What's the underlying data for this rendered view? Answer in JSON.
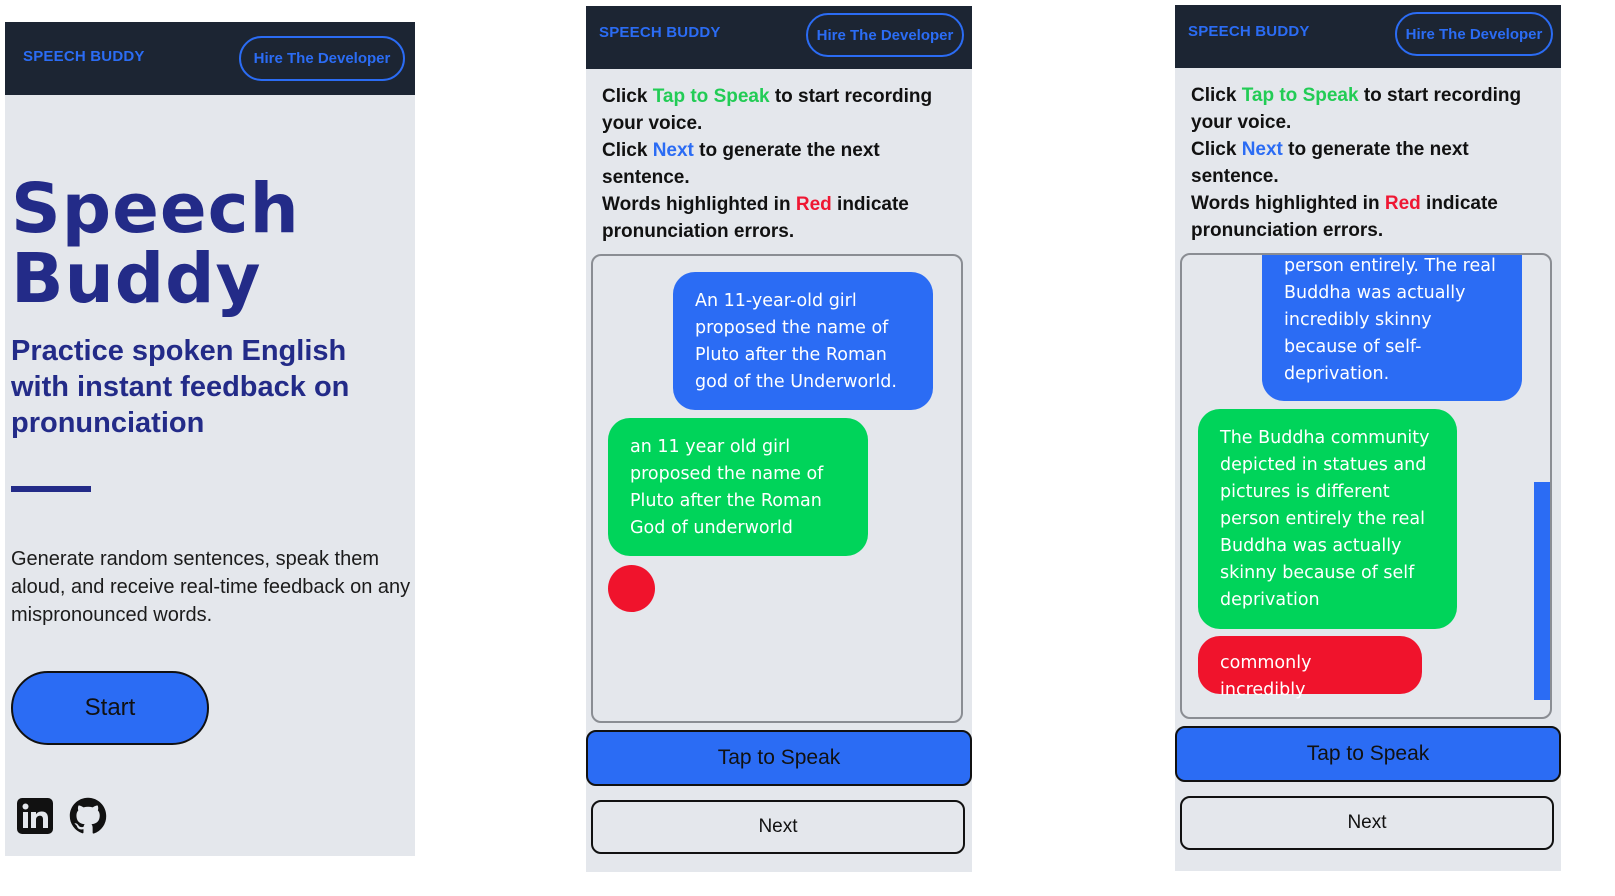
{
  "brand": "SPEECH BUDDY",
  "hire_label": "Hire The Developer",
  "landing": {
    "title_line1": "Speech",
    "title_line2": "Buddy",
    "subtitle": "Practice spoken English with instant feedback on pronunciation",
    "description": "Generate random sentences, speak them aloud, and receive real-time feedback on any mispronounced words.",
    "start_label": "Start",
    "social": [
      "linkedin-icon",
      "github-icon"
    ]
  },
  "instructions": {
    "l1_pre": "Click ",
    "l1_key": "Tap to Speak",
    "l1_post": " to start recording your voice.",
    "l2_pre": "Click ",
    "l2_key": "Next",
    "l2_post": " to generate the next sentence.",
    "l3_pre": "Words highlighted in ",
    "l3_key": "Red",
    "l3_post": " indicate pronunciation errors."
  },
  "practice1": {
    "prompt": "An 11-year-old girl proposed the name of Pluto after the Roman god of the Underworld.",
    "transcript": "an 11 year old girl proposed the name of Pluto after the Roman God of underworld"
  },
  "practice2": {
    "prompt_partial": "person entirely. The real Buddha was actually incredibly skinny because of self-deprivation.",
    "transcript": "The Buddha community depicted in statues and pictures is different person entirely the real Buddha was actually skinny because of self deprivation",
    "errors": "commonly incredibly"
  },
  "tap_label": "Tap to Speak",
  "next_label": "Next",
  "colors": {
    "nav": "#1c2533",
    "accent_blue": "#2b6cf4",
    "green": "#00d45a",
    "red": "#f0132c",
    "heading": "#232b88",
    "screen_bg": "#e4e7ec"
  }
}
